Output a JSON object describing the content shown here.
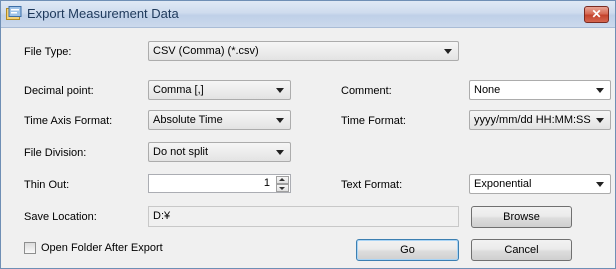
{
  "window": {
    "title": "Export Measurement Data",
    "close_label": "✕"
  },
  "fields": {
    "file_type": {
      "label": "File Type:",
      "value": "CSV (Comma) (*.csv)"
    },
    "decimal_point": {
      "label": "Decimal point:",
      "value": "Comma [,]"
    },
    "comment": {
      "label": "Comment:",
      "value": "None"
    },
    "time_axis_format": {
      "label": "Time Axis Format:",
      "value": "Absolute Time"
    },
    "time_format": {
      "label": "Time Format:",
      "value": "yyyy/mm/dd HH:MM:SS"
    },
    "file_division": {
      "label": "File Division:",
      "value": "Do not split"
    },
    "thin_out": {
      "label": "Thin Out:",
      "value": "1"
    },
    "text_format": {
      "label": "Text Format:",
      "value": "Exponential"
    },
    "save_location": {
      "label": "Save Location:",
      "value": "D:¥"
    }
  },
  "options": {
    "open_folder_label": "Open Folder After Export",
    "open_folder_checked": false
  },
  "buttons": {
    "browse": "Browse",
    "go": "Go",
    "cancel": "Cancel"
  }
}
